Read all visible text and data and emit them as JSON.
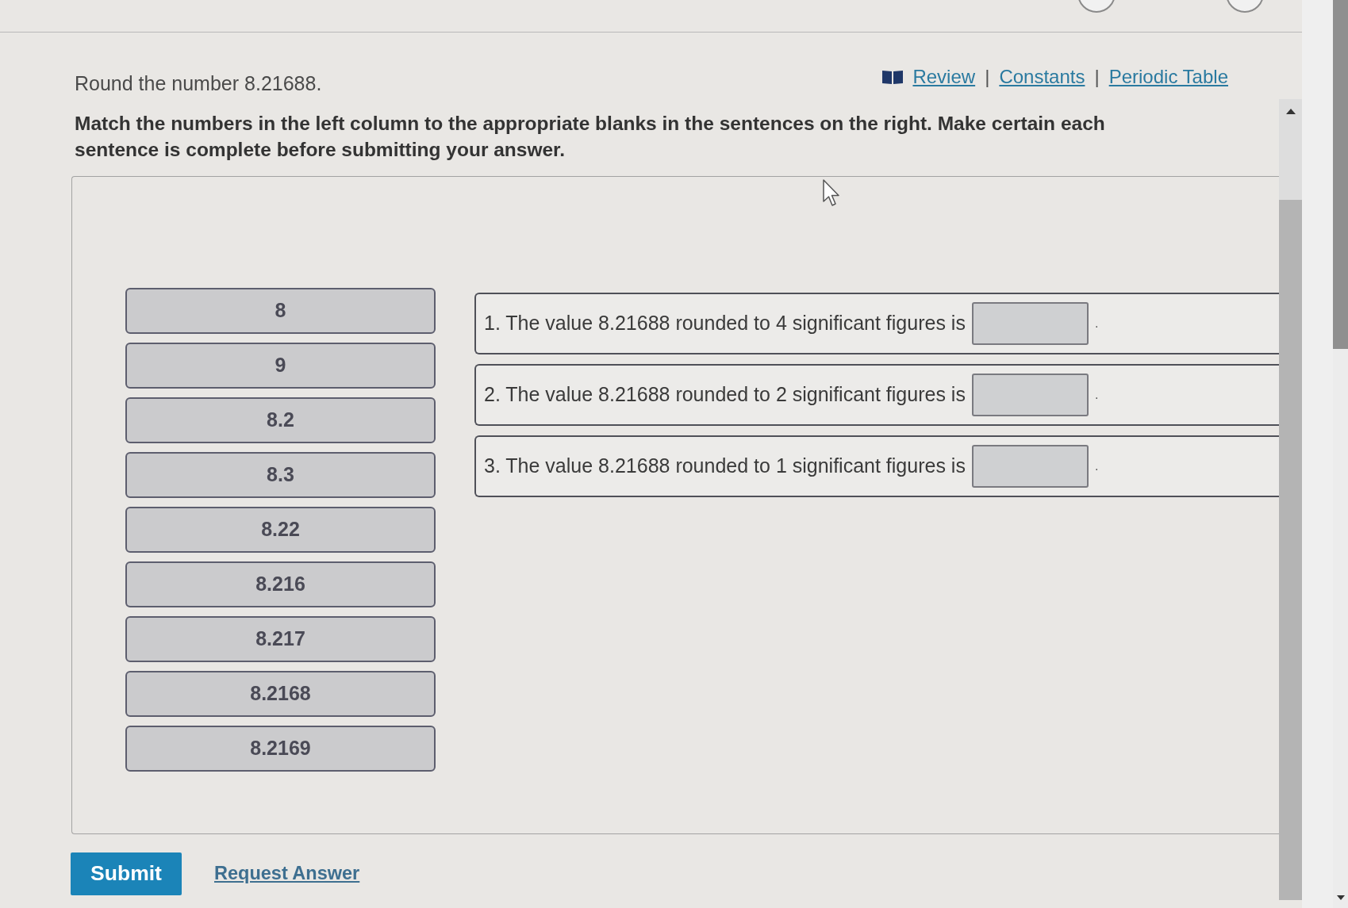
{
  "header": {
    "prompt": "Round the number 8.21688.",
    "links": [
      {
        "label": "Review",
        "icon": true
      },
      {
        "label": "Constants",
        "icon": false
      },
      {
        "label": "Periodic Table",
        "icon": false
      }
    ],
    "separators": [
      "|",
      "|"
    ]
  },
  "instructions": "Match the numbers in the left column to the appropriate blanks in the sentences on the right. Make certain each sentence is complete before submitting your answer.",
  "matching": {
    "choices": [
      "8",
      "9",
      "8.2",
      "8.3",
      "8.22",
      "8.216",
      "8.217",
      "8.2168",
      "8.2169"
    ],
    "sentences": [
      {
        "text": "1. The value 8.21688 rounded to 4 significant figures is",
        "ending": "."
      },
      {
        "text": "2. The value 8.21688 rounded to 2 significant figures is",
        "ending": "."
      },
      {
        "text": "3. The value 8.21688 rounded to 1 significant figures is",
        "ending": "."
      }
    ]
  },
  "actions": {
    "submit": "Submit",
    "request_answer": "Request Answer"
  }
}
